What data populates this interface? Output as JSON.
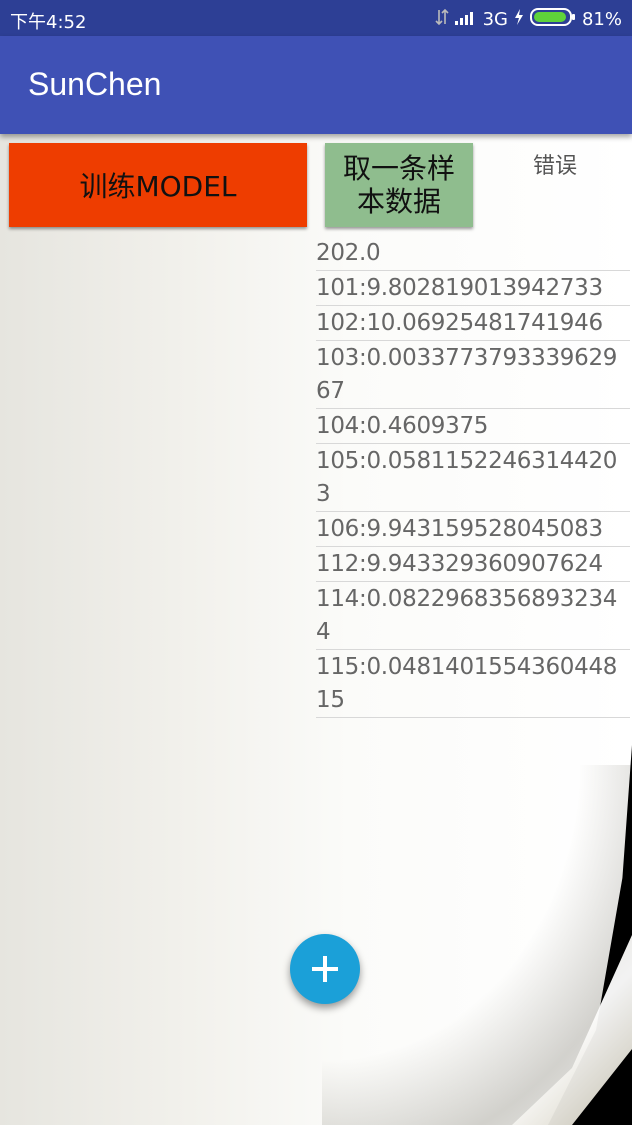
{
  "status_bar": {
    "time": "下午4:52",
    "network": "3G",
    "battery": "81%"
  },
  "app_bar": {
    "title": "SunChen"
  },
  "buttons": {
    "train_label": "训练MODEL",
    "sample_label": "取一条样\n本数据"
  },
  "error_label": "错误",
  "values": [
    "202.0",
    "101:9.802819013942733",
    "102:10.06925481741946",
    "103:0.0033773793339629 67",
    "104:0.4609375",
    "105:0.05811522463144203",
    "106:9.943159528045083",
    "112:9.943329360907624",
    "114:0.08229683568932344",
    "115:0.0481401554360448 15"
  ],
  "colors": {
    "status_bar": "#2d3f95",
    "app_bar": "#3f51b5",
    "train_button": "#ee3d00",
    "sample_button": "#8fbd8e",
    "fab": "#1ba0d8"
  },
  "icons": {
    "fab": "plus-icon"
  }
}
